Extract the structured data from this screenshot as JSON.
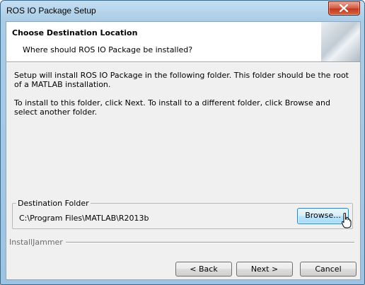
{
  "window": {
    "title": "ROS IO Package Setup",
    "close_icon": "close-x-icon"
  },
  "header": {
    "title": "Choose Destination Location",
    "subtitle": "Where should ROS IO Package be installed?"
  },
  "body": {
    "paragraph1": "Setup will install ROS IO Package in the following folder.  This folder should be the root of a MATLAB installation.",
    "paragraph2": "To install to this folder, click Next.  To install to a different folder, click Browse and select another folder."
  },
  "destination": {
    "legend": "Destination Folder",
    "path": "C:\\Program Files\\MATLAB\\R2013b",
    "browse_label": "Browse..."
  },
  "footer": {
    "brand": "InstallJammer",
    "back_label": "< Back",
    "next_label": "Next >",
    "cancel_label": "Cancel"
  },
  "colors": {
    "titlebar": "#a9cbe6",
    "close": "#c0391f",
    "client_bg": "#f0f0f0"
  }
}
